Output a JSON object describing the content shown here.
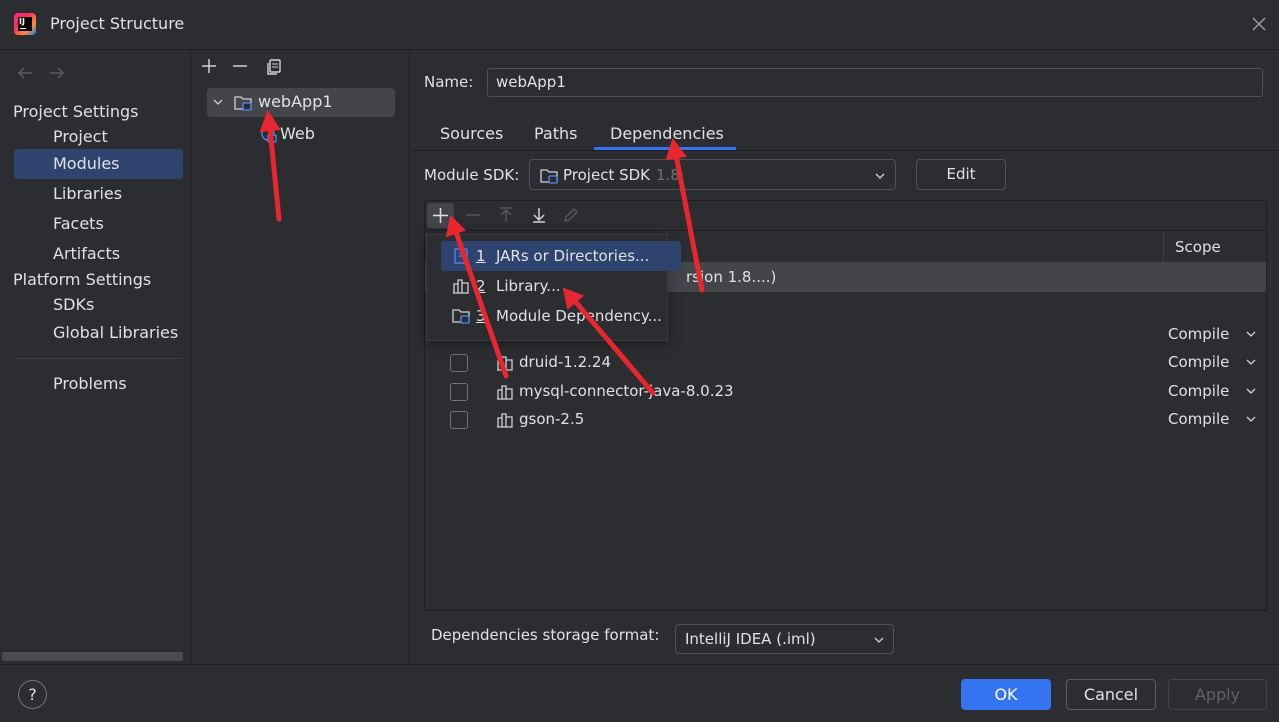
{
  "window": {
    "title": "Project Structure"
  },
  "colors": {
    "accent": "#3574f0",
    "selection": "#2e436e",
    "annotation_arrow": "#e8262f",
    "background": "#2b2d30"
  },
  "nav": {
    "project_settings_header": "Project Settings",
    "project_items": [
      "Project",
      "Modules",
      "Libraries",
      "Facets",
      "Artifacts"
    ],
    "platform_settings_header": "Platform Settings",
    "platform_items": [
      "SDKs",
      "Global Libraries"
    ],
    "problems": "Problems",
    "selected": "Modules"
  },
  "tree": {
    "module": "webApp1",
    "facet": "Web"
  },
  "details": {
    "name_label": "Name:",
    "name_value": "webApp1",
    "tabs": [
      "Sources",
      "Paths",
      "Dependencies"
    ],
    "active_tab": "Dependencies",
    "sdk_label": "Module SDK:",
    "sdk_value": "Project SDK",
    "sdk_version": "1.8",
    "edit_button": "Edit",
    "scope_header": "Scope",
    "sdk_row_text": "rsion 1.8....)",
    "dependencies": [
      {
        "name": "druid-1.2.24",
        "scope": "Compile"
      },
      {
        "name": "mysql-connector-java-8.0.23",
        "scope": "Compile"
      },
      {
        "name": "gson-2.5",
        "scope": "Compile"
      }
    ],
    "hidden_row_scope": "Compile",
    "storage_label": "Dependencies storage format:",
    "storage_value": "IntelliJ IDEA (.iml)"
  },
  "popup": {
    "items": [
      {
        "num": "1",
        "label": "JARs or Directories..."
      },
      {
        "num": "2",
        "label": "Library..."
      },
      {
        "num": "3",
        "label": "Module Dependency..."
      }
    ]
  },
  "footer": {
    "help": "?",
    "ok": "OK",
    "cancel": "Cancel",
    "apply": "Apply"
  },
  "icons": [
    "app-logo-icon",
    "close-icon",
    "back-arrow-icon",
    "forward-arrow-icon",
    "add-icon",
    "remove-icon",
    "copy-icon",
    "chevron-down-icon",
    "folder-module-icon",
    "web-facet-icon",
    "library-icon",
    "move-up-icon",
    "move-down-icon",
    "edit-pencil-icon",
    "help-icon"
  ]
}
